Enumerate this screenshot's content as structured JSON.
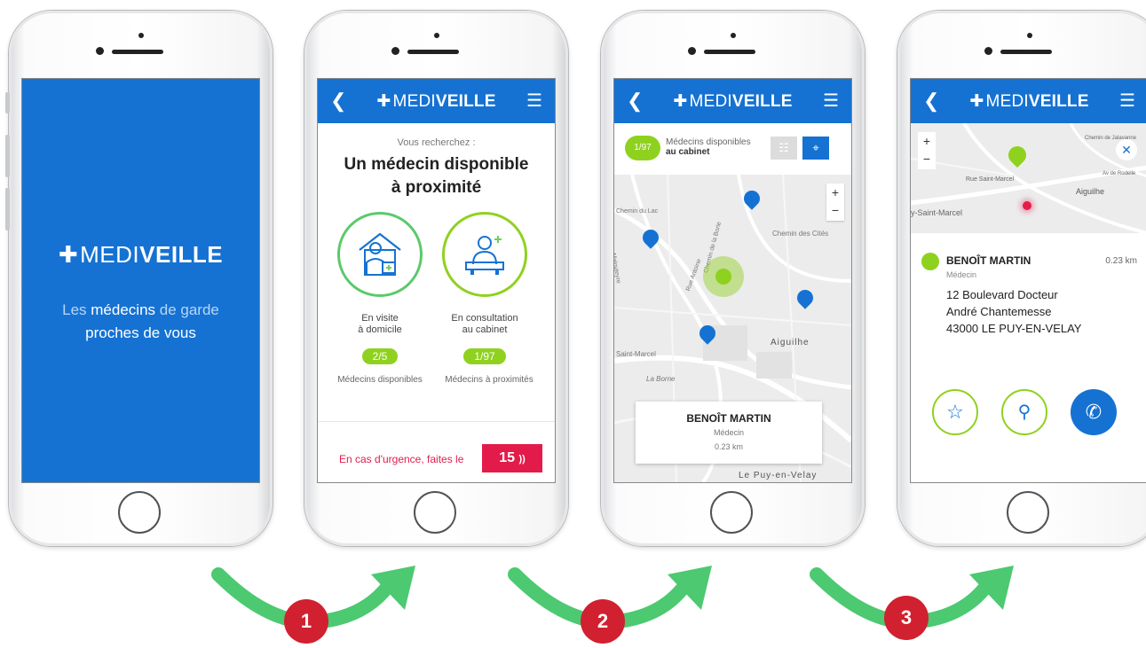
{
  "brand": {
    "light": "MEDI",
    "bold": "VEILLE",
    "cross": "✚"
  },
  "splash": {
    "tag_pre": "Les ",
    "tag_hl1": "médecins",
    "tag_mid": " de garde",
    "tag_line2": "proches de vous"
  },
  "screen2": {
    "subtitle": "Vous recherchez :",
    "title_line1": "Un médecin disponible",
    "title_line2": "à proximité",
    "option1": {
      "line1": "En visite",
      "line2": "à domicile",
      "count": "2/5",
      "caption": "Médecins disponibles"
    },
    "option2": {
      "line1": "En consultation",
      "line2": "au cabinet",
      "count": "1/97",
      "caption": "Médecins à proximités"
    },
    "urgent_text": "En cas d'urgence, faites le",
    "urgent_number": "15"
  },
  "screen3": {
    "count": "1/97",
    "filter_line1": "Médecins disponibles",
    "filter_line2": "au cabinet",
    "map_labels": [
      "Chemin du Lac",
      "Chemin des Cités",
      "Aiguilhe",
      "La Borne",
      "Saint-Marcel",
      "Le Puy-en-Velay",
      "Rue Antoine",
      "Chemin de la Borie",
      "Malouteyre"
    ],
    "card_name": "BENOÎT MARTIN",
    "card_role": "Médecin",
    "card_distance": "0.23 km"
  },
  "screen4": {
    "map_labels": [
      "Aiguilhe",
      "Rue Saint-Marcel",
      "y-Saint-Marcel",
      "Chemin de Jalavanne",
      "Av de Rodelle"
    ],
    "name": "BENOÎT MARTIN",
    "role": "Médecin",
    "distance": "0.23 km",
    "addr1": "12 Boulevard Docteur",
    "addr2": "André Chantemesse",
    "addr3": "43000 LE PUY-EN-VELAY"
  },
  "steps": [
    "1",
    "2",
    "3"
  ],
  "colors": {
    "primary": "#1572d3",
    "green": "#8fd11f",
    "red": "#e31b4b",
    "arrow": "#4cc971",
    "step": "#d1202f"
  }
}
